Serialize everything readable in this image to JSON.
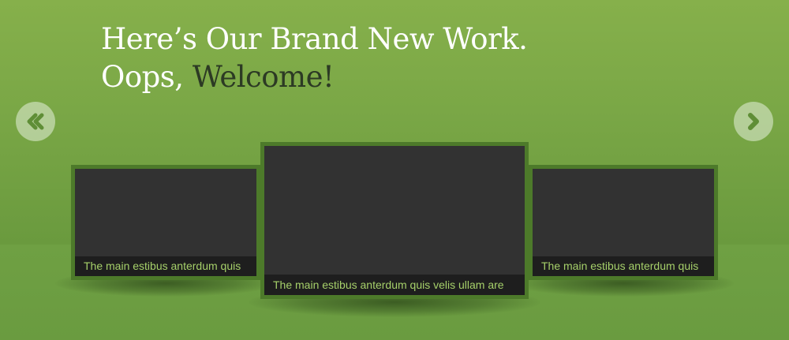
{
  "headline": {
    "line1": "Here’s Our Brand New Work.",
    "line2_prefix": "Oops, ",
    "line2_highlight": "Welcome!"
  },
  "nav": {
    "prev_icon": "chevron-double-left-icon",
    "next_icon": "chevron-right-icon"
  },
  "slides": [
    {
      "caption": "The main estibus anterdum quis"
    },
    {
      "caption": "The main estibus anterdum quis velis ullam are"
    },
    {
      "caption": "The main estibus anterdum quis"
    }
  ],
  "colors": {
    "background": "#7aa746",
    "slide_frame": "#4d7a2a",
    "slide_body": "#323232",
    "caption_text": "#a6d06a",
    "headline_text": "#ffffff",
    "headline_highlight": "#2c3a24"
  }
}
